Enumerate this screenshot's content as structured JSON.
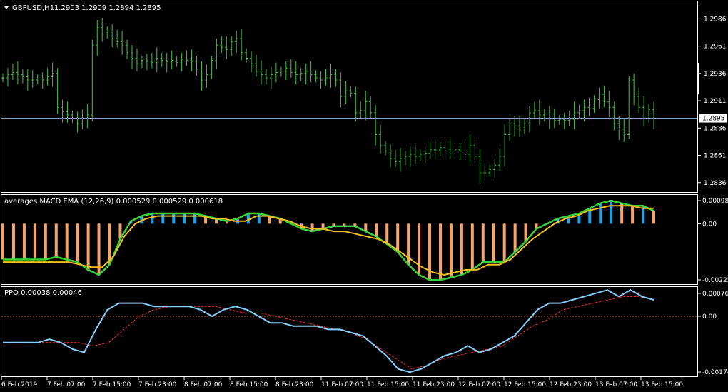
{
  "colors": {
    "background": "#000000",
    "frame": "#ffffff",
    "candle": "#3fc33f",
    "current_price_line": "#8aa0c0",
    "macd_up": "#1ea2e6",
    "macd_down": "#f5a56a",
    "macd_line": "#3cd23c",
    "macd_signal": "#f0c020",
    "ppo_line": "#87cefa",
    "ppo_signal": "#ff3030",
    "zero_line": "#cd6a2a"
  },
  "symbol": {
    "label": "GBPUSD,H1",
    "ohlc": "1.2903 1.2909 1.2894 1.2895",
    "menu_icon": "triangle-down-icon"
  },
  "current_price": "1.2895",
  "price_axis": [
    "1.2986",
    "1.2961",
    "1.2936",
    "1.2911",
    "1.2886",
    "1.2861",
    "1.2836"
  ],
  "macd": {
    "label": "averages MACD EMA (12,26,9) 0.000529 0.000529 0.000618",
    "axis": [
      "0.000986",
      "0.00",
      "-0.00225"
    ]
  },
  "ppo": {
    "label": "PPO 0.00038 0.00046",
    "axis": [
      "0.00076",
      "0.00",
      "-0.00174"
    ]
  },
  "time_axis": [
    "6 Feb 2019",
    "7 Feb 07:00",
    "7 Feb 15:00",
    "7 Feb 23:00",
    "8 Feb 07:00",
    "8 Feb 15:00",
    "8 Feb 23:00",
    "11 Feb 07:00",
    "11 Feb 15:00",
    "11 Feb 23:00",
    "12 Feb 07:00",
    "12 Feb 15:00",
    "12 Feb 23:00",
    "13 Feb 07:00",
    "13 Feb 15:00"
  ],
  "chart_data": [
    {
      "type": "line",
      "title": "GBPUSD,H1",
      "description": "OHLC bar chart, approximate closes per hourly bar",
      "ylim": [
        1.2828,
        1.3
      ],
      "series": [
        {
          "values": [
            1.2932,
            1.2935,
            1.2937,
            1.2935,
            1.2933,
            1.293,
            1.293,
            1.2931,
            1.293,
            1.2933,
            1.2936,
            1.2905,
            1.2901,
            1.2898,
            1.2895,
            1.289,
            1.2895,
            1.2898,
            1.2962,
            1.2978,
            1.2972,
            1.2975,
            1.2968,
            1.2965,
            1.2962,
            1.2955,
            1.295,
            1.2945,
            1.2948,
            1.2947,
            1.2946,
            1.295,
            1.2948,
            1.2947,
            1.2948,
            1.2946,
            1.2949,
            1.2948,
            1.2947,
            1.294,
            1.293,
            1.2935,
            1.2948,
            1.2962,
            1.296,
            1.2958,
            1.2965,
            1.2968,
            1.2955,
            1.295,
            1.2945,
            1.2938,
            1.2935,
            1.2932,
            1.2935,
            1.2937,
            1.2938,
            1.2941,
            1.2937,
            1.2935,
            1.2936,
            1.2938,
            1.2935,
            1.2932,
            1.293,
            1.2932,
            1.2935,
            1.293,
            1.2915,
            1.292,
            1.2918,
            1.29,
            1.2902,
            1.291,
            1.29,
            1.288,
            1.287,
            1.2865,
            1.2858,
            1.2855,
            1.2858,
            1.286,
            1.2862,
            1.286,
            1.2862,
            1.2863,
            1.2866,
            1.2866,
            1.2868,
            1.2867,
            1.2865,
            1.2866,
            1.2865,
            1.2862,
            1.287,
            1.286,
            1.2845,
            1.2845,
            1.2848,
            1.2852,
            1.286,
            1.288,
            1.289,
            1.2888,
            1.2885,
            1.289,
            1.29,
            1.2902,
            1.2898,
            1.2899,
            1.2895,
            1.2893,
            1.2894,
            1.2893,
            1.2894,
            1.29,
            1.2902,
            1.2905,
            1.2904,
            1.2912,
            1.2917,
            1.291,
            1.2905,
            1.289,
            1.2885,
            1.288,
            1.293,
            1.2915,
            1.2905,
            1.2897,
            1.2903,
            1.2895
          ]
        }
      ]
    },
    {
      "type": "bar",
      "title": "averages MACD EMA (12,26,9) 0.000529 0.000529 0.000618",
      "ylim": [
        -0.00225,
        0.000986
      ],
      "series": [
        {
          "name": "MACD",
          "values": [
            -0.0014,
            -0.0014,
            -0.0014,
            -0.0014,
            -0.0014,
            -0.0013,
            -0.0014,
            -0.0015,
            -0.0018,
            -0.002,
            -0.0016,
            -0.0006,
            0.0001,
            0.0003,
            0.0004,
            0.0004,
            0.0004,
            0.0004,
            0.0004,
            0.0003,
            0.0002,
            0.0001,
            0.0002,
            0.0004,
            0.0004,
            0.0003,
            0.0002,
            0.0,
            -0.0002,
            -0.0003,
            -0.0002,
            -0.0001,
            -0.0001,
            -0.0001,
            -0.0003,
            -0.0005,
            -0.0008,
            -0.0011,
            -0.0016,
            -0.002,
            -0.0022,
            -0.0022,
            -0.0021,
            -0.002,
            -0.0018,
            -0.0015,
            -0.0015,
            -0.0015,
            -0.0011,
            -0.0007,
            -0.0002,
            0.0,
            0.0002,
            0.0003,
            0.0004,
            0.0006,
            0.0008,
            0.0009,
            0.0008,
            0.0007,
            0.0007,
            0.0005
          ]
        },
        {
          "name": "Signal",
          "values": [
            -0.0015,
            -0.0015,
            -0.0015,
            -0.0015,
            -0.0015,
            -0.0015,
            -0.0015,
            -0.0016,
            -0.0017,
            -0.0017,
            -0.0013,
            -0.0005,
            0.0,
            0.0002,
            0.0003,
            0.0003,
            0.0003,
            0.0003,
            0.0003,
            0.0002,
            0.0002,
            0.0001,
            0.0001,
            0.0003,
            0.0003,
            0.0002,
            0.0001,
            -0.0001,
            -0.0002,
            -0.0002,
            -0.0003,
            -0.0003,
            -0.0004,
            -0.0005,
            -0.0006,
            -0.0008,
            -0.0011,
            -0.0014,
            -0.0017,
            -0.0019,
            -0.002,
            -0.0019,
            -0.0018,
            -0.0018,
            -0.0016,
            -0.0016,
            -0.0014,
            -0.001,
            -0.0006,
            -0.0003,
            0.0,
            0.0002,
            0.0003,
            0.0005,
            0.0006,
            0.0007,
            0.0007,
            0.0007,
            0.0006,
            0.0006
          ]
        }
      ]
    },
    {
      "type": "line",
      "title": "PPO 0.00038 0.00046",
      "ylim": [
        -0.00174,
        0.00076
      ],
      "series": [
        {
          "name": "PPO",
          "values": [
            -0.0008,
            -0.0008,
            -0.0008,
            -0.0008,
            -0.0007,
            -0.0008,
            -0.001,
            -0.0011,
            -0.0004,
            0.0002,
            0.0004,
            0.0004,
            0.0004,
            0.0003,
            0.0003,
            0.0003,
            0.0003,
            0.0002,
            0.0,
            0.0002,
            0.0003,
            0.0002,
            0.0,
            -0.0002,
            -0.0002,
            -0.0003,
            -0.0003,
            -0.0003,
            -0.0004,
            -0.0004,
            -0.0005,
            -0.0006,
            -0.0009,
            -0.0012,
            -0.0016,
            -0.0017,
            -0.0016,
            -0.0014,
            -0.0012,
            -0.0011,
            -0.0009,
            -0.0011,
            -0.001,
            -0.0008,
            -0.0006,
            -0.0002,
            0.0002,
            0.0004,
            0.0004,
            0.0005,
            0.0006,
            0.0007,
            0.0008,
            0.0006,
            0.0008,
            0.0006,
            0.0005
          ]
        },
        {
          "name": "Signal",
          "values": [
            -0.0008,
            -0.0008,
            -0.0008,
            -0.0008,
            -0.0008,
            -0.0008,
            -0.0009,
            -0.0008,
            -0.0004,
            0.0,
            0.0002,
            0.0003,
            0.0003,
            0.0003,
            0.0003,
            0.0002,
            0.0001,
            0.0001,
            0.0,
            -0.0001,
            -0.0002,
            -0.0003,
            -0.0004,
            -0.0005,
            -0.0007,
            -0.001,
            -0.0013,
            -0.0016,
            -0.0015,
            -0.0013,
            -0.0012,
            -0.0011,
            -0.001,
            -0.0009,
            -0.0006,
            -0.0003,
            -0.0001,
            0.0002,
            0.0003,
            0.0004,
            0.0005,
            0.0006,
            0.0006,
            0.0005
          ]
        }
      ]
    }
  ]
}
